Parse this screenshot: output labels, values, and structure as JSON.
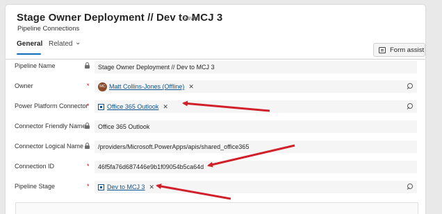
{
  "header": {
    "title": "Stage Owner Deployment // Dev to MCJ 3",
    "save_state": "- Saved",
    "entity": "Pipeline Connections",
    "tabs": [
      {
        "label": "General",
        "selected": true
      },
      {
        "label": "Related",
        "selected": false
      }
    ],
    "form_assist": "Form assist"
  },
  "fields": {
    "pipeline_name": {
      "label": "Pipeline Name",
      "value": "Stage Owner Deployment // Dev to MCJ 3",
      "locked": true
    },
    "owner": {
      "label": "Owner",
      "value": "Matt Collins-Jones (Offline)",
      "avatar_initials": "MC",
      "required": true
    },
    "connector": {
      "label": "Power Platform Connector",
      "value": "Office 365 Outlook",
      "required": true
    },
    "friendly_name": {
      "label": "Connector Friendly Name",
      "value": "Office 365 Outlook",
      "locked": true
    },
    "logical_name": {
      "label": "Connector Logical Name",
      "value": "/providers/Microsoft.PowerApps/apis/shared_office365",
      "locked": true
    },
    "connection_id": {
      "label": "Connection ID",
      "value": "46f5fa76d687446e9b1f09054b5ca64d",
      "required": true
    },
    "pipeline_stage": {
      "label": "Pipeline Stage",
      "value": "Dev to MCJ 3",
      "required": true
    }
  },
  "colors": {
    "link": "#0f548c",
    "accent": "#0f6cbd",
    "annotation_arrow": "#d0202a",
    "required": "#b10e1c"
  },
  "icons": [
    "lock-icon",
    "search-icon",
    "close-icon",
    "entity-icon",
    "form-assist-icon",
    "chevron-down-icon"
  ]
}
